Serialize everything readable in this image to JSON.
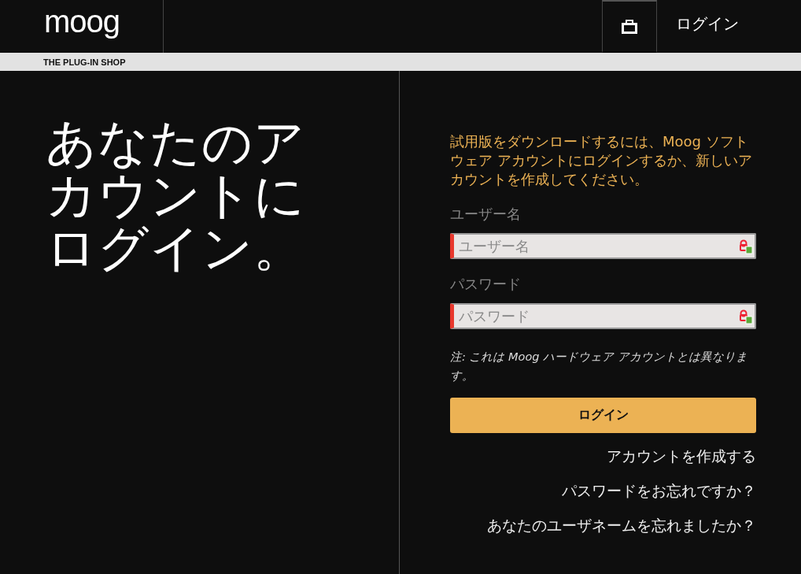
{
  "header": {
    "logo": "moog",
    "login_link": "ログイン"
  },
  "subbar": {
    "label": "THE PLUG-IN SHOP"
  },
  "hero": {
    "heading": "あなたのアカウントにログイン。"
  },
  "form": {
    "intro": "試用版をダウンロードするには、Moog ソフトウェア アカウントにログインするか、新しいアカウントを作成してください。",
    "fields": [
      {
        "label": "ユーザー名",
        "placeholder": "ユーザー名",
        "invalid": true
      },
      {
        "label": "パスワード",
        "placeholder": "パスワード",
        "invalid": true
      }
    ],
    "note": "注: これは Moog ハードウェア アカウントとは異なります。",
    "submit": "ログイン",
    "links": [
      "アカウントを作成する",
      "パスワードをお忘れですか？",
      "あなたのユーザネームを忘れましたか？"
    ]
  }
}
